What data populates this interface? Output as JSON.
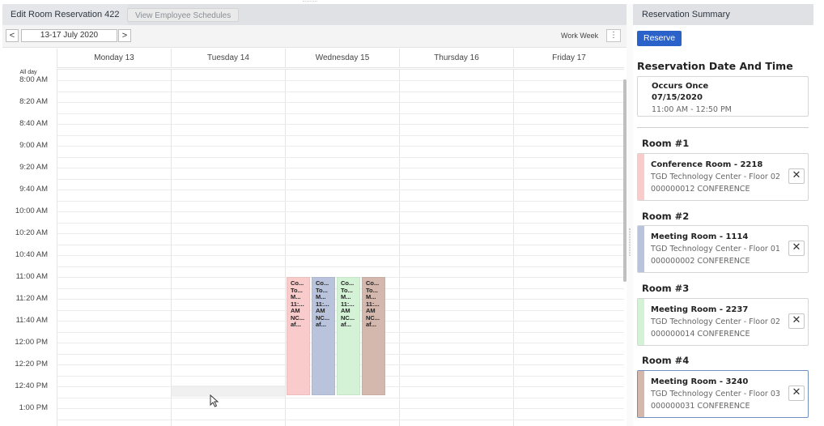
{
  "tabs": {
    "active": "Edit Room Reservation 422",
    "inactive": "View Employee Schedules"
  },
  "toolbar": {
    "prev_glyph": "<",
    "next_glyph": ">",
    "date_range": "13-17 July 2020",
    "view_mode": "Work Week",
    "more_glyph": "⋮"
  },
  "calendar": {
    "all_day_label": "All day",
    "days": [
      "Monday 13",
      "Tuesday 14",
      "Wednesday 15",
      "Thursday 16",
      "Friday 17"
    ],
    "times": [
      "8:00 AM",
      "8:20 AM",
      "8:40 AM",
      "9:00 AM",
      "9:20 AM",
      "9:40 AM",
      "10:00 AM",
      "10:20 AM",
      "10:40 AM",
      "11:00 AM",
      "11:20 AM",
      "11:40 AM",
      "12:00 PM",
      "12:20 PM",
      "12:40 PM",
      "1:00 PM"
    ],
    "events": [
      {
        "lines": [
          "Co...",
          "To...",
          "M...",
          "11:...",
          "AM",
          "NC...",
          "af..."
        ],
        "color": "#f9cbcb"
      },
      {
        "lines": [
          "Co...",
          "To...",
          "M...",
          "11:...",
          "AM",
          "NC...",
          "af..."
        ],
        "color": "#b9c4dc"
      },
      {
        "lines": [
          "Co...",
          "To...",
          "M...",
          "11:...",
          "AM",
          "NC...",
          "af..."
        ],
        "color": "#d4f3d6"
      },
      {
        "lines": [
          "Co...",
          "To...",
          "M...",
          "11:...",
          "AM",
          "NC...",
          "af..."
        ],
        "color": "#d4b8ad"
      }
    ]
  },
  "summary": {
    "header": "Reservation Summary",
    "reserve_label": "Reserve",
    "date_time_title": "Reservation Date And Time",
    "occurs": "Occurs Once",
    "date": "07/15/2020",
    "time_range": "11:00 AM - 12:50 PM",
    "remove_glyph": "✕",
    "rooms": [
      {
        "heading": "Room #1",
        "name": "Conference Room - 2218",
        "location": "TGD Technology Center - Floor 02",
        "code": "000000012 CONFERENCE",
        "color": "#f9cbcb"
      },
      {
        "heading": "Room #2",
        "name": "Meeting Room - 1114",
        "location": "TGD Technology Center - Floor 01",
        "code": "000000002 CONFERENCE",
        "color": "#b9c4dc"
      },
      {
        "heading": "Room #3",
        "name": "Meeting Room - 2237",
        "location": "TGD Technology Center - Floor 02",
        "code": "000000014 CONFERENCE",
        "color": "#d4f3d6"
      },
      {
        "heading": "Room #4",
        "name": "Meeting Room - 3240",
        "location": "TGD Technology Center - Floor 03",
        "code": "000000031 CONFERENCE",
        "color": "#d4b8ad"
      }
    ]
  }
}
